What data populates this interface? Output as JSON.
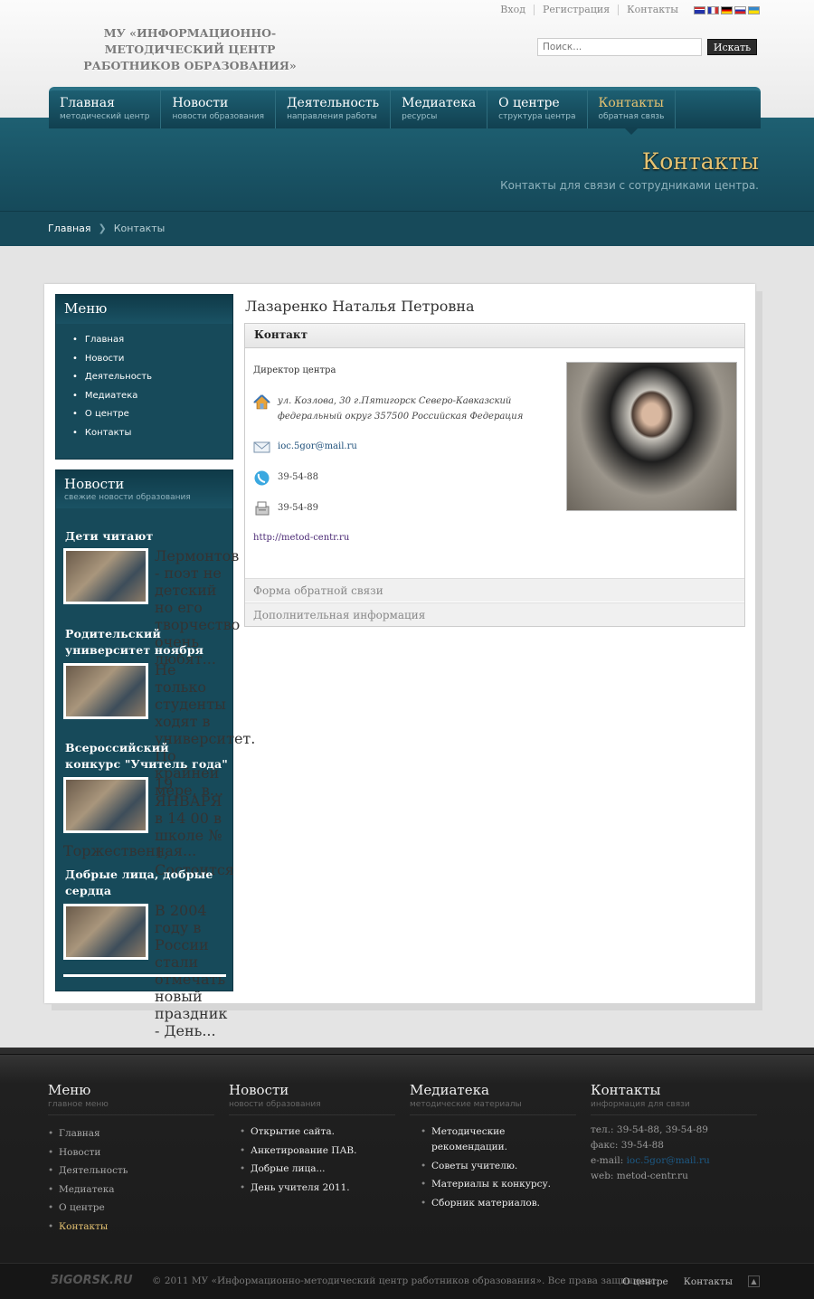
{
  "header": {
    "logo_line1": "МУ «ИНФОРМАЦИОННО-МЕТОДИЧЕСКИЙ ЦЕНТР",
    "logo_line2": "РАБОТНИКОВ ОБРАЗОВАНИЯ»",
    "toplinks": [
      "Вход",
      "Регистрация",
      "Контакты"
    ],
    "search_placeholder": "Поиск...",
    "search_button": "Искать"
  },
  "nav": [
    {
      "title": "Главная",
      "sub": "методический центр"
    },
    {
      "title": "Новости",
      "sub": "новости образования"
    },
    {
      "title": "Деятельность",
      "sub": "направления работы"
    },
    {
      "title": "Медиатека",
      "sub": "ресурсы"
    },
    {
      "title": "О центре",
      "sub": "структура центра"
    },
    {
      "title": "Контакты",
      "sub": "обратная связь"
    }
  ],
  "page": {
    "title": "Контакты",
    "subtitle": "Контакты для связи с сотрудниками центра.",
    "breadcrumb_home": "Главная",
    "breadcrumb_current": "Контакты"
  },
  "sidebar": {
    "menu_title": "Меню",
    "menu_items": [
      "Главная",
      "Новости",
      "Деятельность",
      "Медиатека",
      "О центре",
      "Контакты"
    ],
    "news_title": "Новости",
    "news_sub": "свежие новости образования",
    "news": [
      {
        "title": "Дети читают Лермонтова",
        "text": "Лермонтов - поэт не детский но его творчество очень любят..."
      },
      {
        "title": "Родительский университет ноября",
        "text": "Не только студенты ходят в университет. По крайней мере, в..."
      },
      {
        "title": "Всероссийский конкурс \"Учитель года\"",
        "text": "19 ЯНВАРЯ в 14 00 в школе № 1, Состоится",
        "text2": "Торжественная..."
      },
      {
        "title": "Добрые лица, добрые сердца",
        "text": "В 2004 году в России стали отмечать новый праздник - День..."
      }
    ]
  },
  "contact": {
    "name": "Лазаренко Наталья Петровна",
    "section": "Контакт",
    "position": "Директор центра",
    "address": "ул. Козлова, 30 г.Пятигорск Северо-Кавказский федеральный округ 357500 Российская Федерация",
    "email": "ioc.5gor@mail.ru",
    "phone": "39-54-88",
    "fax": "39-54-89",
    "website": "http://metod-centr.ru",
    "form_label": "Форма обратной связи",
    "extra_label": "Дополнительная информация"
  },
  "footer": {
    "col1_title": "Меню",
    "col1_sub": "главное меню",
    "col1_items": [
      "Главная",
      "Новости",
      "Деятельность",
      "Медиатека",
      "О центре",
      "Контакты"
    ],
    "col2_title": "Новости",
    "col2_sub": "новости образования",
    "col2_items": [
      "Открытие сайта.",
      "Анкетирование ПАВ.",
      "Добрые лица...",
      "День учителя 2011."
    ],
    "col3_title": "Медиатека",
    "col3_sub": "методические материалы",
    "col3_items": [
      "Методические рекомендации.",
      "Советы учителю.",
      "Материалы к конкурсу.",
      "Сборник материалов."
    ],
    "col4_title": "Контакты",
    "col4_sub": "информация для связи",
    "tel": "тел.: 39-54-88, 39-54-89",
    "fax": "факс: 39-54-88",
    "email_label": "e-mail:",
    "email": "ioc.5gor@mail.ru",
    "web": "web: metod-centr.ru",
    "logo": "5IGORSK.RU",
    "copyright": "© 2011 МУ «Информационно-методический центр работников образования». Все права защищены.",
    "bottom_links": [
      "О центре",
      "Контакты"
    ]
  },
  "colors": {
    "accent": "#e5c271",
    "band": "#174a5a"
  }
}
